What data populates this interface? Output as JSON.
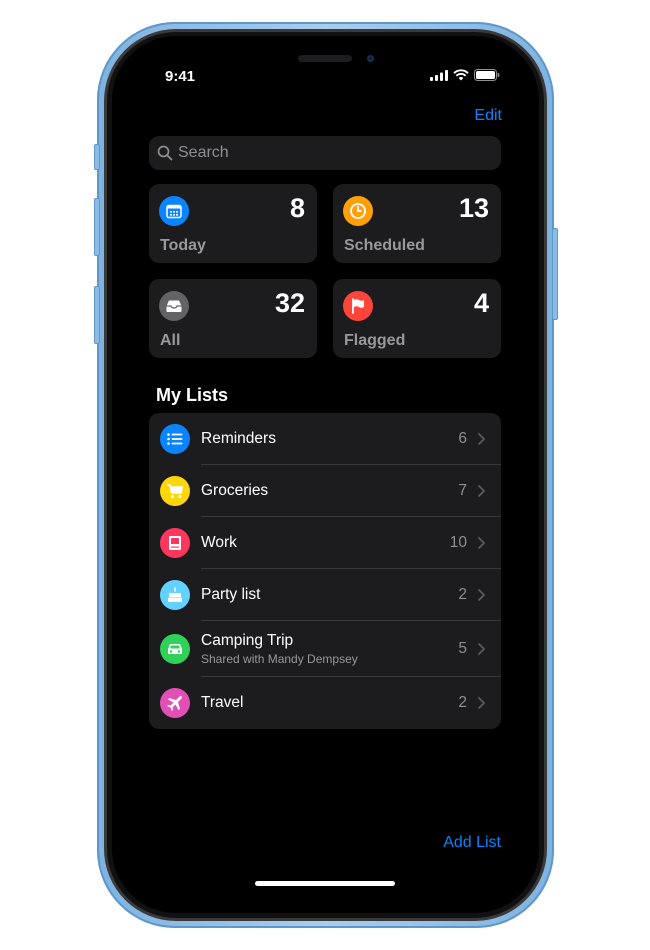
{
  "status_bar": {
    "time": "9:41"
  },
  "nav": {
    "edit_label": "Edit"
  },
  "search": {
    "placeholder": "Search"
  },
  "summary_tiles": [
    {
      "label": "Today",
      "count": "8",
      "icon": "calendar-icon",
      "color": "#0a84ff"
    },
    {
      "label": "Scheduled",
      "count": "13",
      "icon": "clock-icon",
      "color": "#ff9f0a"
    },
    {
      "label": "All",
      "count": "32",
      "icon": "tray-icon",
      "color": "#636366"
    },
    {
      "label": "Flagged",
      "count": "4",
      "icon": "flag-icon",
      "color": "#ff453a"
    }
  ],
  "my_lists": {
    "title": "My Lists",
    "items": [
      {
        "name": "Reminders",
        "count": "6",
        "icon": "list-bullet-icon",
        "color": "#0a84ff"
      },
      {
        "name": "Groceries",
        "count": "7",
        "icon": "cart-icon",
        "color": "#ffd60a"
      },
      {
        "name": "Work",
        "count": "10",
        "icon": "desktop-icon",
        "color": "#ff375f"
      },
      {
        "name": "Party list",
        "count": "2",
        "icon": "birthday-cake-icon",
        "color": "#64d2ff"
      },
      {
        "name": "Camping Trip",
        "subtitle": "Shared with Mandy Dempsey",
        "count": "5",
        "icon": "car-icon",
        "color": "#30d158"
      },
      {
        "name": "Travel",
        "count": "2",
        "icon": "airplane-icon",
        "color": "#e24fb5"
      }
    ]
  },
  "footer": {
    "add_list_label": "Add List"
  },
  "colors": {
    "accent": "#0a84ff",
    "background": "#000000",
    "card": "#1c1c1e",
    "frame": "#a9cdee"
  }
}
